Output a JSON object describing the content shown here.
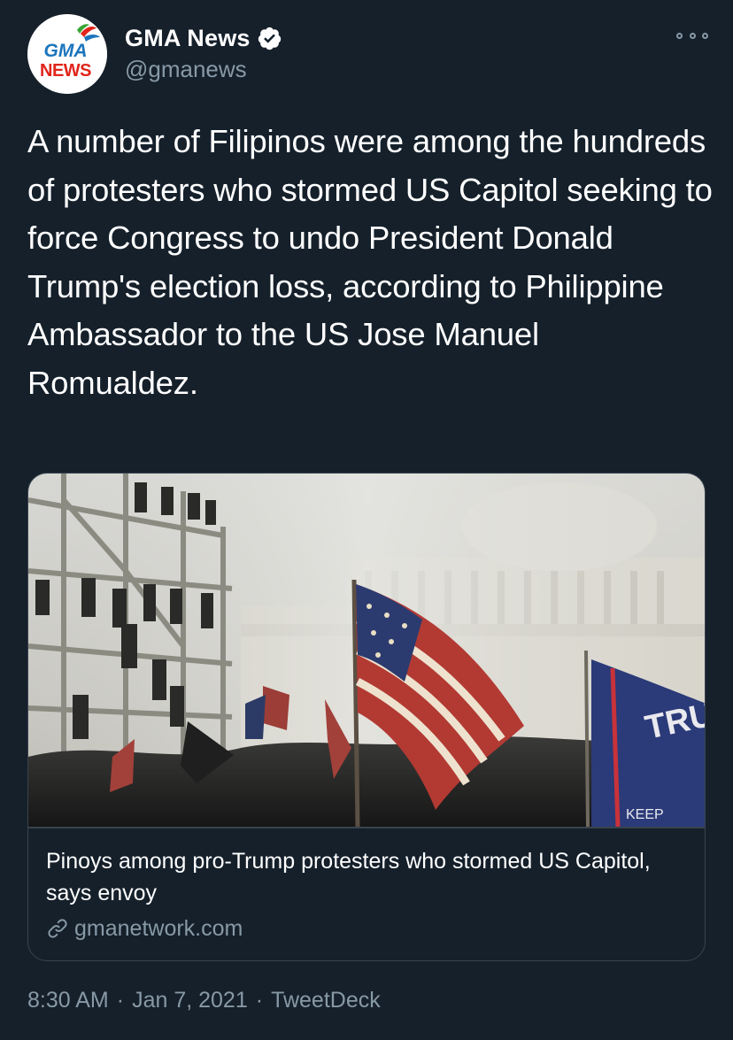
{
  "user": {
    "display_name": "GMA News",
    "handle": "@gmanews",
    "verified": true,
    "avatar_logo_text": [
      "GMA",
      "NEWS"
    ]
  },
  "tweet": {
    "text": "A number of Filipinos were among the hundreds of protesters who stormed US Capitol seeking to force Congress to undo President Donald Trump's election loss, according to Philippine Ambassador to the US Jose Manuel Romualdez."
  },
  "card": {
    "image_alt_subject": "protest-at-us-capitol-photo",
    "title": "Pinoys among pro-Trump protesters who stormed US Capitol, says envoy",
    "domain": "gmanetwork.com"
  },
  "meta": {
    "time": "8:30 AM",
    "separator": "·",
    "date": "Jan 7, 2021",
    "source": "TweetDeck"
  },
  "icons": {
    "verified": "verified-badge-icon",
    "more": "more-options-icon",
    "link": "link-icon"
  },
  "colors": {
    "background": "#15202b",
    "primary_text": "#ffffff",
    "secondary_text": "#8899a6",
    "border": "#38444d",
    "gma_red": "#e0251b",
    "gma_blue": "#1c75bc"
  }
}
